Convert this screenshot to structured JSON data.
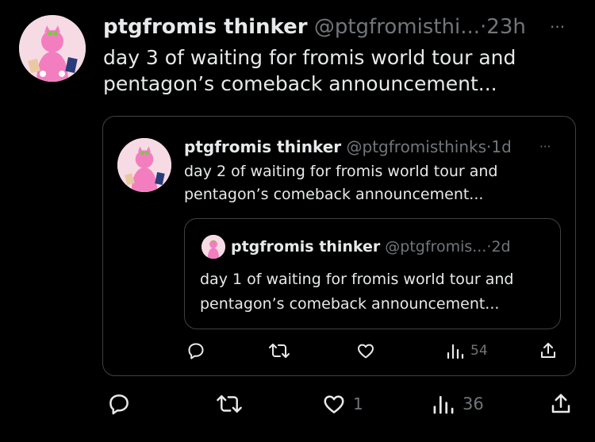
{
  "tweet": {
    "display_name": "ptgfromis thinker",
    "handle": "@ptgfromisthi...",
    "separator": "·",
    "time": "23h",
    "more_label": "···",
    "text_line1": "day 3 of waiting for fromis world tour and",
    "text_line2": "pentagon’s comeback announcement...",
    "actions": {
      "reply_count": "",
      "retweet_count": "",
      "like_count": "1",
      "views_count": "36"
    }
  },
  "quote1": {
    "display_name": "ptgfromis thinker",
    "handle": "@ptgfromisthinks",
    "separator": "·",
    "time": "1d",
    "more_label": "···",
    "text_line1": "day 2 of waiting for fromis world tour and",
    "text_line2": "pentagon’s comeback announcement...",
    "actions": {
      "views_count": "54"
    }
  },
  "quote2": {
    "display_name": "ptgfromis thinker",
    "handle": "@ptgfromis...",
    "separator": "·",
    "time": "2d",
    "text_line1": "day 1 of waiting for fromis world tour and",
    "text_line2": "pentagon’s comeback announcement..."
  },
  "colors": {
    "background": "#000000",
    "text": "#e7e9ea",
    "muted": "#71767b",
    "border": "#3e4144",
    "avatar_bg": "#f6dbe4",
    "avatar_figure": "#f27ec0"
  }
}
